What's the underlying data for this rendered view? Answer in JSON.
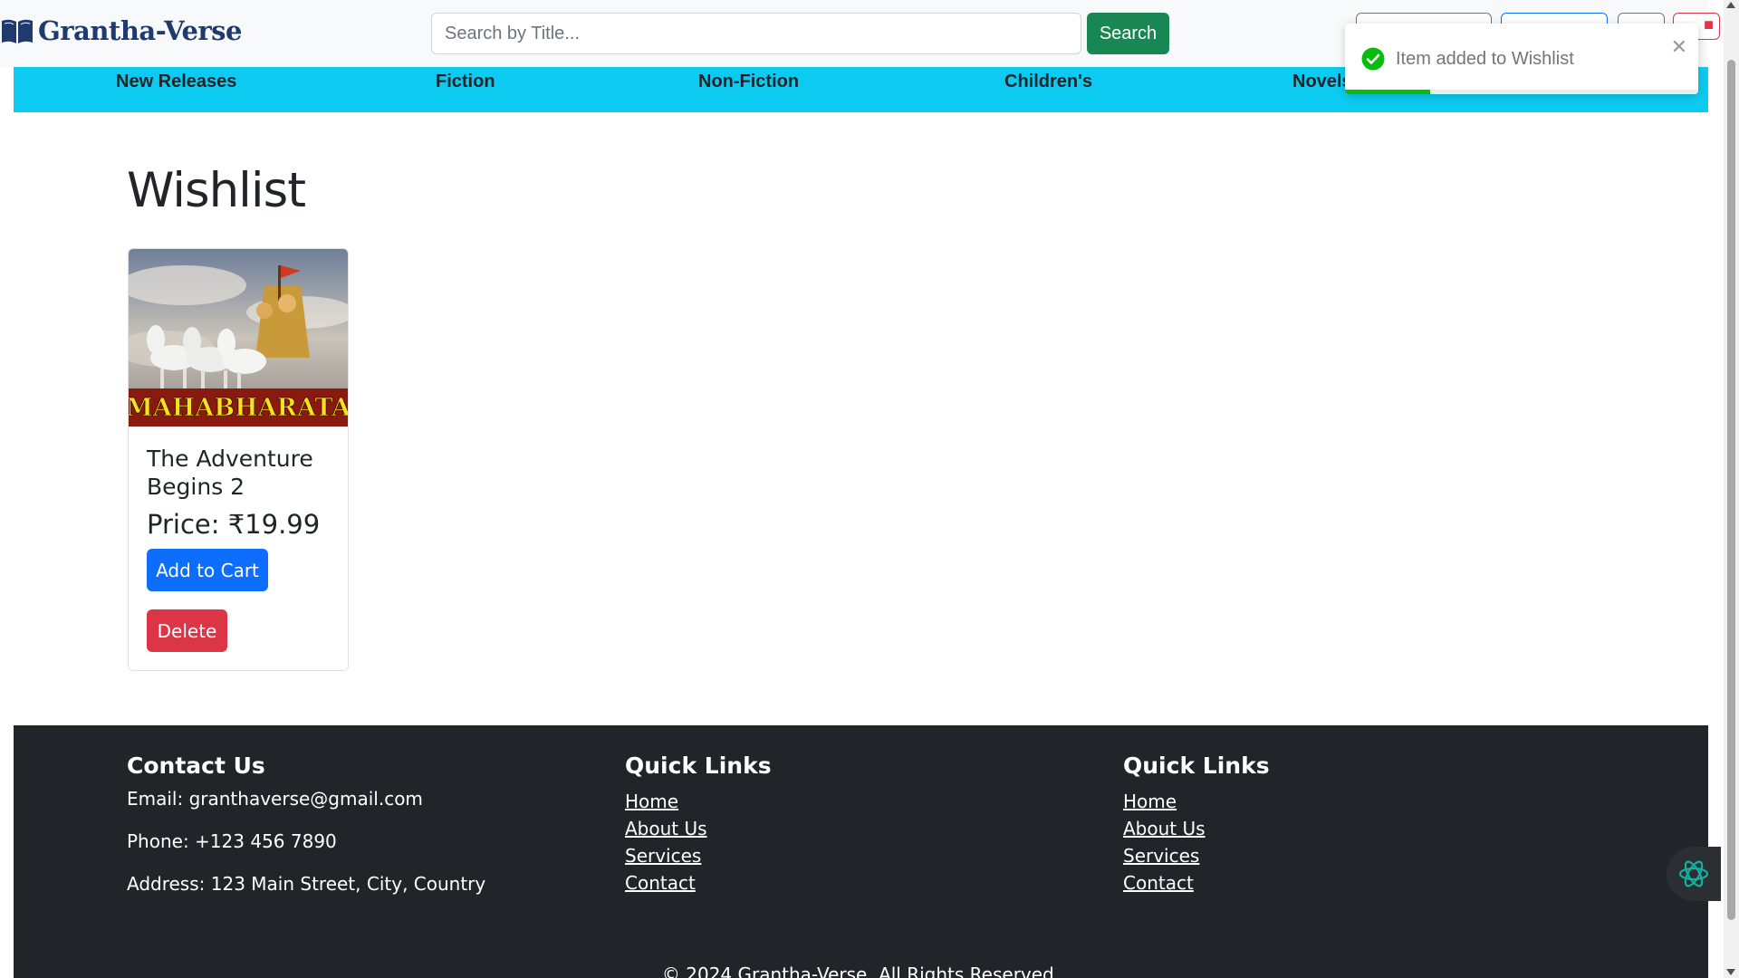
{
  "brand": {
    "name": "Grantha-Verse",
    "logo_icon": "open-book-icon",
    "color": "#1e3a6e"
  },
  "search": {
    "placeholder": "Search by Title...",
    "value": "",
    "button_label": "Search"
  },
  "nav": {
    "items": [
      {
        "label": "New Releases"
      },
      {
        "label": "Fiction"
      },
      {
        "label": "Non-Fiction"
      },
      {
        "label": "Children's"
      },
      {
        "label": "Novels"
      }
    ],
    "background": "#0dcaf0"
  },
  "main": {
    "title": "Wishlist",
    "items": [
      {
        "cover_text": "MAHABHARATA",
        "title": "The Adventure Begins 2",
        "price": "Price: ₹19.99",
        "add_to_cart_label": "Add to Cart",
        "delete_label": "Delete"
      }
    ]
  },
  "footer": {
    "contact": {
      "heading": "Contact Us",
      "email": "Email: granthaverse@gmail.com",
      "phone": "Phone: +123 456 7890",
      "address": "Address: 123 Main Street, City, Country"
    },
    "quick_links_1": {
      "heading": "Quick Links",
      "links": [
        "Home",
        "About Us",
        "Services",
        "Contact"
      ]
    },
    "quick_links_2": {
      "heading": "Quick Links",
      "links": [
        "Home",
        "About Us",
        "Services",
        "Contact"
      ]
    },
    "copyright": "© 2024 Grantha-Verse. All Rights Reserved."
  },
  "toast": {
    "message": "Item added to Wishlist",
    "icon": "check-circle-icon",
    "close_icon": "close-icon",
    "progress_fraction": 0.24,
    "accent": "#07bc0c"
  },
  "colors": {
    "success": "#198754",
    "primary": "#0d6efd",
    "danger": "#dc3545",
    "footer_bg": "#212529"
  }
}
